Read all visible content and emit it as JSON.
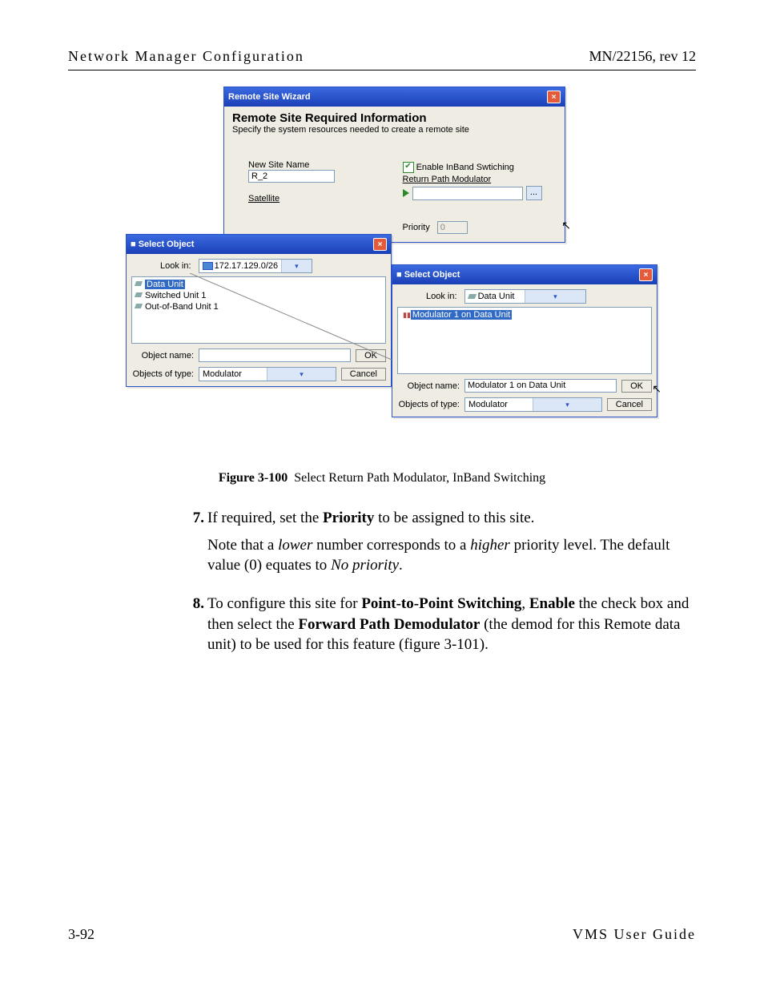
{
  "header": {
    "left": "Network Manager Configuration",
    "right": "MN/22156, rev 12"
  },
  "wizard": {
    "title": "Remote Site Wizard",
    "heading": "Remote Site Required Information",
    "subheading": "Specify the system resources needed to create a remote site",
    "new_site_label": "New Site Name",
    "new_site_value": "R_2",
    "satellite_label": "Satellite",
    "enable_inband_label": "Enable InBand Swtiching",
    "return_path_label": "Return Path Modulator",
    "priority_label": "Priority",
    "priority_value": "0"
  },
  "select1": {
    "title": "Select Object",
    "lookin_label": "Look in:",
    "lookin_value": "172.17.129.0/26",
    "items": [
      "Data Unit",
      "Switched Unit 1",
      "Out-of-Band Unit 1"
    ],
    "object_name_label": "Object name:",
    "object_name_value": "",
    "objects_type_label": "Objects of type:",
    "objects_type_value": "Modulator",
    "ok": "OK",
    "cancel": "Cancel"
  },
  "select2": {
    "title": "Select Object",
    "lookin_label": "Look in:",
    "lookin_value": "Data Unit",
    "items": [
      "Modulator 1 on Data Unit"
    ],
    "object_name_label": "Object name:",
    "object_name_value": "Modulator 1 on Data Unit",
    "objects_type_label": "Objects of type:",
    "objects_type_value": "Modulator",
    "ok": "OK",
    "cancel": "Cancel"
  },
  "caption": {
    "label": "Figure 3-100",
    "text": "Select Return Path Modulator, InBand Switching"
  },
  "body": {
    "step7_num": "7.",
    "step7_a": "If required, set the ",
    "step7_b": "Priority",
    "step7_c": " to be assigned to this site.",
    "step7_note_a": "Note that a ",
    "step7_note_b": "lower",
    "step7_note_c": " number corresponds to a ",
    "step7_note_d": "higher",
    "step7_note_e": " priority level. The default value (0) equates to ",
    "step7_note_f": "No priority",
    "step7_note_g": ".",
    "step8_num": "8.",
    "step8_a": "To configure this site for ",
    "step8_b": "Point-to-Point Switching",
    "step8_c": ", ",
    "step8_d": "Enable",
    "step8_e": " the check box and then select the ",
    "step8_f": "Forward Path Demodulator",
    "step8_g": " (the demod for this Remote data unit) to be used for this feature (figure 3-101)."
  },
  "footer": {
    "left": "3-92",
    "right": "VMS User Guide"
  }
}
